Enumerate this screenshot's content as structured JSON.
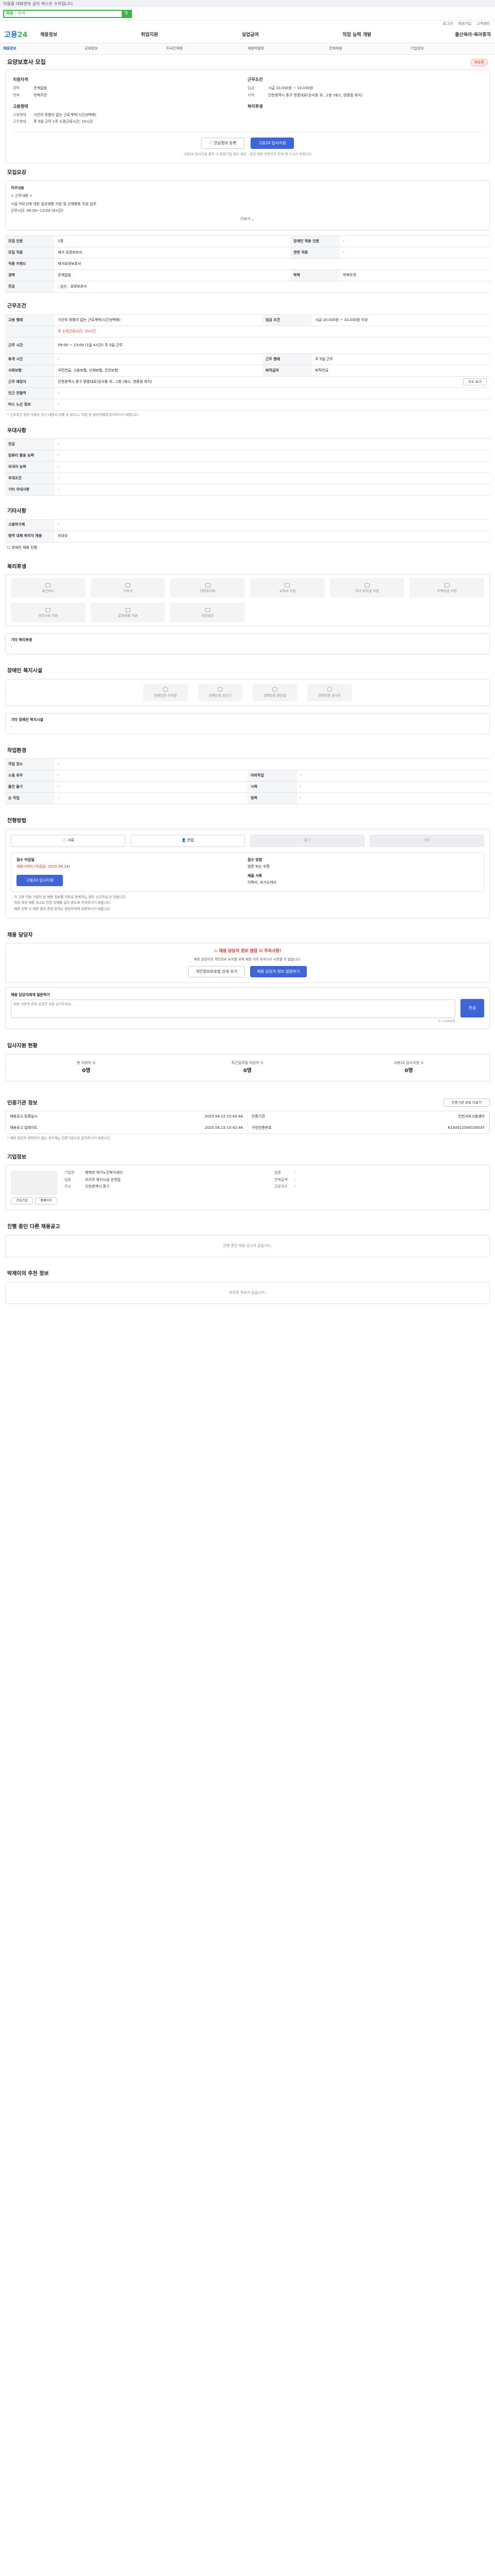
{
  "notice": "이용중 대화면의 글자 텍스트 수치입니다.",
  "search": {
    "tab": "채용",
    "placeholder": "검색",
    "btn": "검색"
  },
  "util": [
    "로그인",
    "회원가입",
    "고객센터"
  ],
  "logo": {
    "a": "고용",
    "b": "24"
  },
  "gnb": [
    "채용정보",
    "취업지원",
    "실업급여",
    "직업 능력 개발",
    "출산육아·육아휴직"
  ],
  "subnav": [
    "채용정보",
    "공채정보",
    "외국인채용",
    "채용박람회",
    "전체채용",
    "기업정보"
  ],
  "title": "요양보호사 모집",
  "badge": "채용중",
  "summary": {
    "left_head": "지원자격",
    "left": [
      {
        "k": "경력",
        "v": "관계없음"
      },
      {
        "k": "학력",
        "v": "학력무관"
      }
    ],
    "left2_head": "고용형태",
    "left2": [
      {
        "k": "고용형태",
        "v": "기간의 정함이 없는 근로계약(시간선택제)"
      },
      {
        "k": "근무형태",
        "v": "주 5일 근무 1주 소정근로시간: 15시간"
      }
    ],
    "right_head": "근무조건",
    "right": [
      {
        "k": "임금",
        "v": "시급 10,030원 ~ 10,030원"
      },
      {
        "k": "지역",
        "v": "인천광역시 중구 영종대로(운서동 외...1층 (에스, 영종점 위치)"
      }
    ],
    "right2_head": "복리후생",
    "right2": []
  },
  "actions": {
    "scrap": "관심정보 등록",
    "apply": "고용24 입사지원"
  },
  "hint": "고용24 입사지원 클릭 시 회원가입 필요 제공 · 관련 채용 전용번호 안내 해 주시기 바랍니다",
  "recruit": {
    "title": "모집요강",
    "desc_head": "직무내용",
    "desc": [
      "< 근무내용 >",
      "시설 어르신에 대한 일상생활 지원 및 신체활동 지원 업무",
      "근무시간: 09:00~13:00 (4시간)"
    ],
    "more": "더보기",
    "rows": [
      [
        {
          "h": "모집 인원",
          "v": "1명"
        },
        {
          "h": "장애인 채용 인원",
          "v": "-"
        }
      ],
      [
        {
          "h": "모집 직종",
          "v": "재가 요양보호사"
        },
        {
          "h": "관련 직종",
          "v": "-"
        }
      ],
      [
        {
          "h": "직종 키워드",
          "v": "재가요양보호사"
        },
        {
          "h": "",
          "v": ""
        }
      ],
      [
        {
          "h": "경력",
          "v": "관계없음"
        },
        {
          "h": "학력",
          "v": "학력무관"
        }
      ],
      [
        {
          "h": "전공",
          "v": "-"
        },
        {
          "h": "",
          "v": ""
        }
      ]
    ],
    "major_tag": "필수",
    "major_v": "요양보호사"
  },
  "cond": {
    "title": "근무조건",
    "rows": [
      [
        {
          "h": "고용 형태",
          "v": "기간의 정함이 없는 근로계약(시간선택제)"
        },
        {
          "h": "임금 조건",
          "v": "시급 10,030원 ~ 10,030원 이상"
        }
      ],
      [
        {
          "h": "",
          "v": "주 소정근로시간: 15시간"
        },
        {
          "h": "",
          "v": ""
        }
      ],
      [
        {
          "h": "근무 시간",
          "v": "09:00 ~ 13:00 (1일 4시간) 주 5일 근무"
        },
        {
          "h": "",
          "v": ""
        }
      ],
      [
        {
          "h": "휴게 시간",
          "v": "-"
        },
        {
          "h": "근무 형태",
          "v": "주 5일 근무"
        }
      ],
      [
        {
          "h": "사회보험",
          "v": "국민연금, 고용보험, 산재보험, 건강보험"
        },
        {
          "h": "퇴직급여",
          "v": "퇴직연금"
        }
      ],
      [
        {
          "h": "근무 예정지",
          "v": "인천광역시 중구 영종대로(운서동 외...1층 (에스, 영종점 위치)"
        },
        {
          "h": "",
          "v": ""
        }
      ],
      [
        {
          "h": "인근 전철역",
          "v": "-"
        },
        {
          "h": "",
          "v": ""
        }
      ],
      [
        {
          "h": "버스 노선 정보",
          "v": "-"
        },
        {
          "h": "",
          "v": ""
        }
      ]
    ],
    "map_btn": "지도 보기",
    "note": "* 근로조건 관련 사항은 상기 내용과 다를 수 있으니, 지원 전 담당자에게 문의하시기 바랍니다."
  },
  "prefer": {
    "title": "우대사항",
    "rows": [
      {
        "h": "전공",
        "v": "-"
      },
      {
        "h": "컴퓨터 활용 능력",
        "v": "-"
      },
      {
        "h": "외국어 능력",
        "v": "-"
      },
      {
        "h": "우대조건",
        "v": "-"
      },
      {
        "h": "기타 우대사항",
        "v": "-"
      }
    ]
  },
  "etc": {
    "title": "기타사항",
    "rows": [
      {
        "h": "고용허가제",
        "v": "-"
      },
      {
        "h": "병역 대체 복무자 채용",
        "v": "비대상"
      }
    ],
    "check": "장애인 채용 진행 "
  },
  "welfare": {
    "title": "복리후생",
    "items": [
      "통근버스",
      "기숙사",
      "차량유지비",
      "교육비 지원",
      "자녀 학자금 지원",
      "주택자금 지원",
      "경조사비 지원",
      "문화생활 지원",
      "건강검진"
    ],
    "other_head": "기타 복리후생",
    "other_val": "-"
  },
  "facility": {
    "title": "장애인 복지시설",
    "items": [
      "장애인용 주차장",
      "장애인용 승강기",
      "장애인용 화장실",
      "장애인용 경사로"
    ],
    "other_head": "기타 장애인 복지시설",
    "other_val": "-"
  },
  "env": {
    "title": "작업환경",
    "rows": [
      [
        {
          "h": "작업 장소",
          "v": "-"
        },
        {
          "h": "",
          "v": ""
        }
      ],
      [
        {
          "h": "소음 유무",
          "v": "-"
        },
        {
          "h": "야외작업",
          "v": "-"
        }
      ],
      [
        {
          "h": "물건 들기",
          "v": "-"
        },
        {
          "h": "시력",
          "v": "-"
        }
      ],
      [
        {
          "h": "손 작업",
          "v": "-"
        },
        {
          "h": "청력",
          "v": "-"
        }
      ]
    ]
  },
  "process": {
    "title": "전형방법",
    "steps": [
      "서류",
      "면접",
      "필기",
      "기타"
    ],
    "deadline_head": "접수 마감일",
    "deadline": "채용시까지 (마감일: 2025.04.24)",
    "method_head": "접수 방법",
    "method": "방문 또는 우편",
    "docs_head": "제출 서류",
    "docs": "이력서, 자기소개서",
    "apply_btn": "고용24 입사지원",
    "notes": [
      "· 각 고용 지원 기업이 본 채용 정보를 허위로 등록하는 경우 신고하실 수 있습니다.",
      "· 허위·과장 채용 공고로 인한 피해를 입지 않도록 주의하시기 바랍니다.",
      "· 채용 진행 시 채용 절차 관련 문의는 담당자에게 연락하시기 바랍니다."
    ]
  },
  "manager": {
    "title": "채용 담당자",
    "warn": "채용 담당자 정보 열람 시 주의사항!",
    "desc": "채용 담당자의 개인정보 보호를 위해 채용 이외 목적으로 사용할 수 없습니다.",
    "btn1": "개인정보보호법 상세 보기",
    "btn2": "채용 담당자 정보 열람하기",
    "qa_head": "채용 담당자에게 질문하기",
    "qa_placeholder": "채용 내용에 관해 궁금한 점을 남겨주세요.",
    "qa_btn": "전송",
    "qa_count": "0 / 1000자"
  },
  "status": {
    "title": "입사지원 현황",
    "items": [
      {
        "label": "총 지원자 수",
        "n": "0명"
      },
      {
        "label": "최근일주일 지원자 수",
        "n": "0명"
      },
      {
        "label": "고용24 입사지원 수",
        "n": "0명"
      }
    ]
  },
  "cert": {
    "title": "인증기관 정보",
    "btn": "인증기관 정보 더보기",
    "rows": [
      [
        {
          "k": "채용공고 등록일시",
          "v": "2025.04.15 15:42:44"
        },
        {
          "k": "인증기관",
          "v": "인천서부고용센터"
        }
      ],
      [
        {
          "k": "채용공고 업데이트",
          "v": "2025.04.15 15:42:44"
        },
        {
          "k": "구인인증번호",
          "v": "K130012504150037"
        }
      ]
    ],
    "note": "* 채용 담당자 연락처가 없는 경우에는 인증기관으로 문의하시기 바랍니다."
  },
  "company": {
    "title": "기업정보",
    "rows": [
      [
        {
          "k": "기업명",
          "v": "행복한 재가노인복지센터"
        },
        {
          "k": "업종",
          "v": "-"
        }
      ],
      [
        {
          "k": "업종",
          "v": "비거주 복지시설 운영업"
        },
        {
          "k": "연매출액",
          "v": "-"
        }
      ],
      [
        {
          "k": "주소",
          "v": "인천광역시 중구"
        },
        {
          "k": "근로자수",
          "v": "-"
        }
      ]
    ],
    "btn1": "관심기업",
    "btn2": "홈페이지"
  },
  "others": {
    "title": "진행 중인 다른 채용공고",
    "empty": "진행 중인 채용 공고가 없습니다."
  },
  "recommend": {
    "title": "박제이의 추천 정보",
    "empty": "추천된 정보가 없습니다."
  }
}
